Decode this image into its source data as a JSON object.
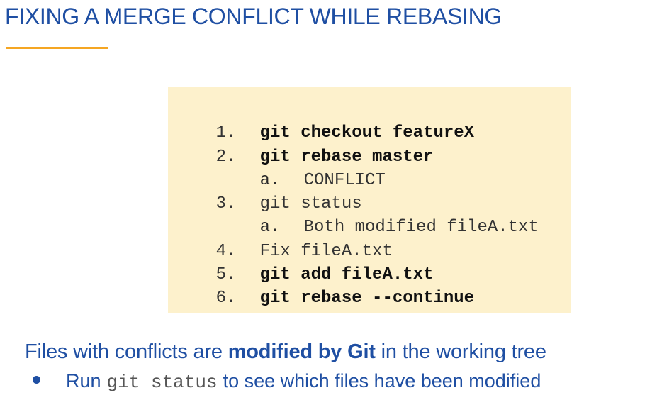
{
  "slide": {
    "title": "FIXING A MERGE CONFLICT WHILE REBASING"
  },
  "steps": [
    {
      "num": "1.",
      "text": "git checkout featureX",
      "bold": true
    },
    {
      "num": "2.",
      "text": "git rebase master",
      "bold": true
    },
    {
      "letter": "a.",
      "text": "CONFLICT",
      "bold": false,
      "sub": true
    },
    {
      "num": "3.",
      "text": "git status",
      "bold": false
    },
    {
      "letter": "a.",
      "text": "Both modified fileA.txt",
      "bold": false,
      "sub": true
    },
    {
      "num": "4.",
      "text": "Fix fileA.txt",
      "bold": false
    },
    {
      "num": "5.",
      "text": "git add fileA.txt",
      "bold": true
    },
    {
      "num": "6.",
      "text": "git rebase --continue",
      "bold": true
    }
  ],
  "point": {
    "before": "Files with conflicts are ",
    "emphasis": "modified by Git",
    "after": " in the working tree"
  },
  "subpoint": {
    "before": "Run",
    "code": "git status",
    "after": "to see which files have been modified"
  },
  "colors": {
    "title": "#1f4fa3",
    "underline": "#f5a623",
    "code_bg": "#fdf1cc"
  }
}
